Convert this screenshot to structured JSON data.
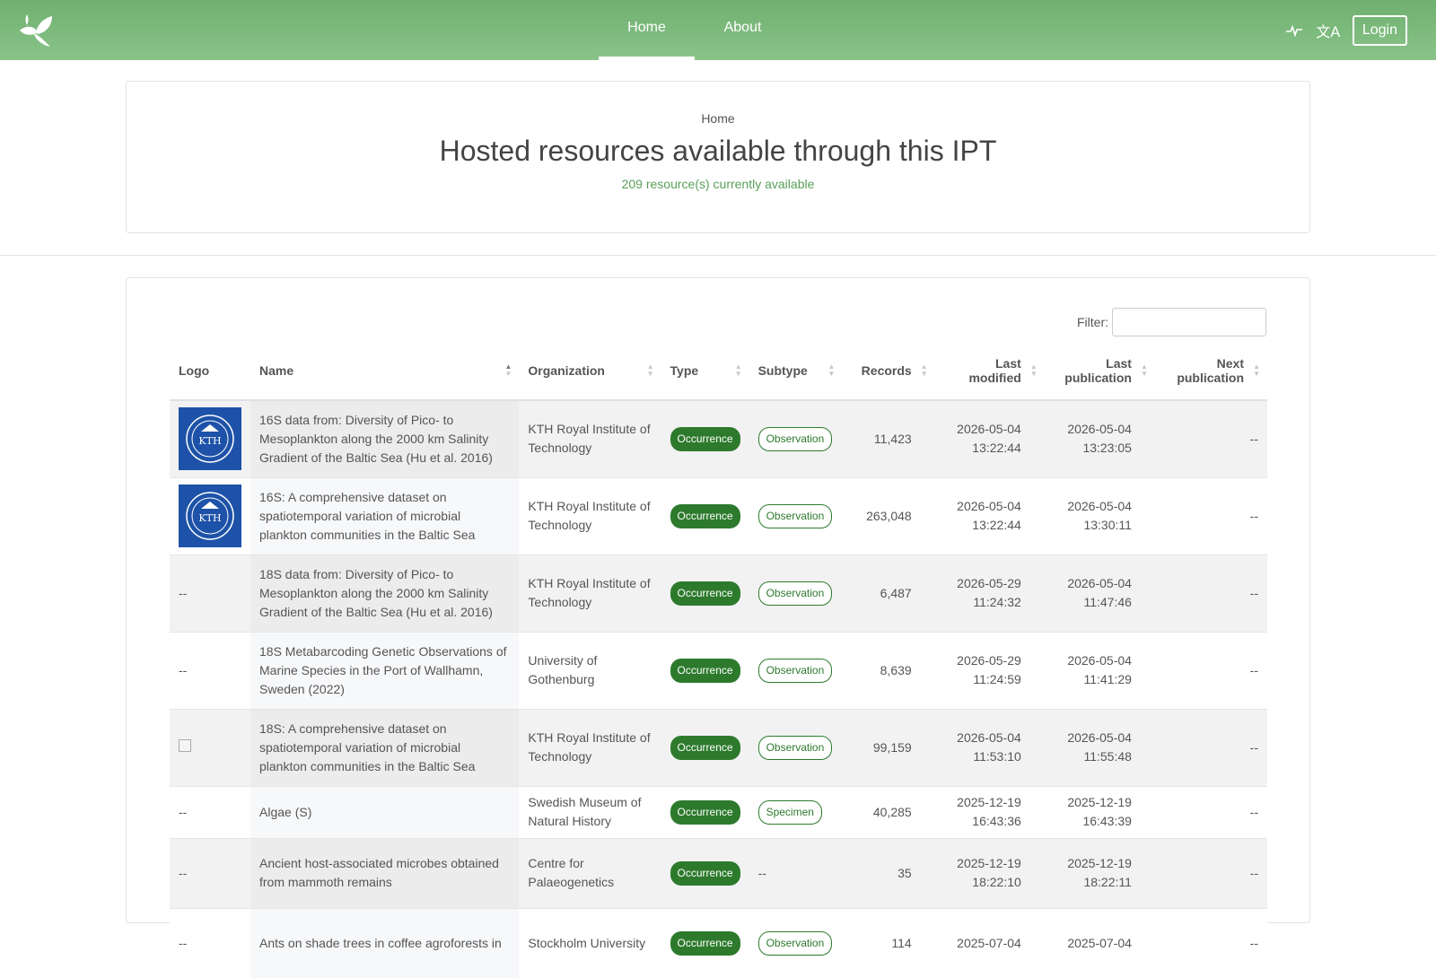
{
  "nav": {
    "links": [
      {
        "label": "Home"
      },
      {
        "label": "About"
      }
    ],
    "login_label": "Login",
    "icons": [
      "health-icon",
      "translate-icon"
    ]
  },
  "header": {
    "breadcrumb": "Home",
    "title": "Hosted resources available through this IPT",
    "count": "209 resource(s) currently available"
  },
  "filter": {
    "label": "Filter:",
    "value": ""
  },
  "table": {
    "columns": [
      "Logo",
      "Name",
      "Organization",
      "Type",
      "Subtype",
      "Records",
      "Last modified",
      "Last publication",
      "Next publication"
    ],
    "rows": [
      {
        "logo": "kth",
        "name": "16S data from: Diversity of Pico- to Mesoplankton along the 2000 km Salinity Gradient of the Baltic Sea (Hu et al. 2016)",
        "organization": "KTH Royal Institute of Technology",
        "type": "Occurrence",
        "subtype": "Observation",
        "records": "11,423",
        "last_modified": [
          "2026-05-04",
          "13:22:44"
        ],
        "last_publication": [
          "2026-05-04",
          "13:23:05"
        ],
        "next_publication": "--"
      },
      {
        "logo": "kth",
        "name": "16S: A comprehensive dataset on spatiotemporal variation of microbial plankton communities in the Baltic Sea",
        "organization": "KTH Royal Institute of Technology",
        "type": "Occurrence",
        "subtype": "Observation",
        "records": "263,048",
        "last_modified": [
          "2026-05-04",
          "13:22:44"
        ],
        "last_publication": [
          "2026-05-04",
          "13:30:11"
        ],
        "next_publication": "--"
      },
      {
        "logo": "--",
        "name": "18S data from: Diversity of Pico- to Mesoplankton along the 2000 km Salinity Gradient of the Baltic Sea (Hu et al. 2016)",
        "organization": "KTH Royal Institute of Technology",
        "type": "Occurrence",
        "subtype": "Observation",
        "records": "6,487",
        "last_modified": [
          "2026-05-29",
          "11:24:32"
        ],
        "last_publication": [
          "2026-05-04",
          "11:47:46"
        ],
        "next_publication": "--"
      },
      {
        "logo": "--",
        "name": "18S Metabarcoding Genetic Observations of Marine Species in the Port of Wallhamn, Sweden (2022)",
        "organization": "University of Gothenburg",
        "type": "Occurrence",
        "subtype": "Observation",
        "records": "8,639",
        "last_modified": [
          "2026-05-29",
          "11:24:59"
        ],
        "last_publication": [
          "2026-05-04",
          "11:41:29"
        ],
        "next_publication": "--"
      },
      {
        "logo": "broken",
        "name": "18S: A comprehensive dataset on spatiotemporal variation of microbial plankton communities in the Baltic Sea",
        "organization": "KTH Royal Institute of Technology",
        "type": "Occurrence",
        "subtype": "Observation",
        "records": "99,159",
        "last_modified": [
          "2026-05-04",
          "11:53:10"
        ],
        "last_publication": [
          "2026-05-04",
          "11:55:48"
        ],
        "next_publication": "--"
      },
      {
        "logo": "--",
        "name": "Algae (S)",
        "organization": "Swedish Museum of Natural History",
        "type": "Occurrence",
        "subtype": "Specimen",
        "records": "40,285",
        "last_modified": [
          "2025-12-19",
          "16:43:36"
        ],
        "last_publication": [
          "2025-12-19",
          "16:43:39"
        ],
        "next_publication": "--"
      },
      {
        "logo": "--",
        "name": "Ancient host-associated microbes obtained from mammoth remains",
        "organization": "Centre for Palaeogenetics",
        "type": "Occurrence",
        "subtype": "--",
        "records": "35",
        "last_modified": [
          "2025-12-19",
          "18:22:10"
        ],
        "last_publication": [
          "2025-12-19",
          "18:22:11"
        ],
        "next_publication": "--"
      },
      {
        "logo": "--",
        "name": "Ants on shade trees in coffee agroforests in",
        "organization": "Stockholm University",
        "type": "Occurrence",
        "subtype": "Observation",
        "records": "114",
        "last_modified": [
          "2025-07-04",
          ""
        ],
        "last_publication": [
          "2025-07-04",
          ""
        ],
        "next_publication": "--"
      }
    ]
  },
  "colors": {
    "nav_green": "#7fbd7f",
    "badge_green": "#2d7a2d",
    "count_green": "#5aa05a",
    "kth_blue": "#1d52a8"
  }
}
